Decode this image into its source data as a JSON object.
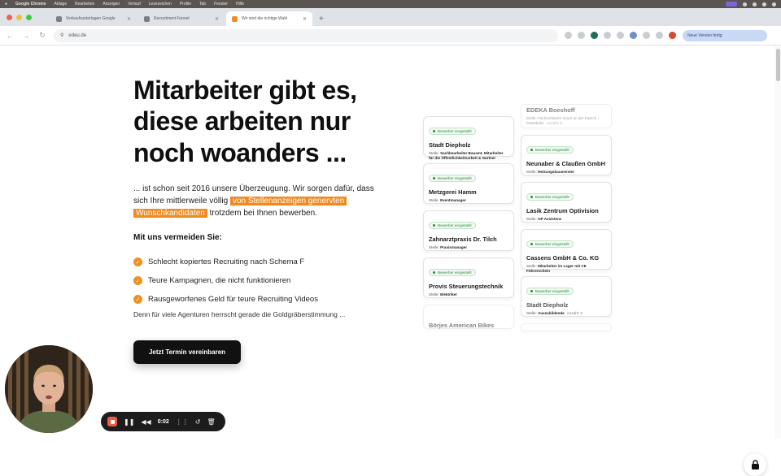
{
  "os_menubar": {
    "app_name": "Google Chrome",
    "menus": [
      "Ablage",
      "Bearbeiten",
      "Anzeigen",
      "Verlauf",
      "Lesezeichen",
      "Profile",
      "Tab",
      "Fenster",
      "Hilfe"
    ]
  },
  "browser": {
    "tabs": [
      {
        "title": "Verkaufsunterlagen Google",
        "active": false
      },
      {
        "title": "Recruitment Funnel",
        "active": false
      },
      {
        "title": "Wir sind die richtige Wahl",
        "active": true
      }
    ],
    "new_tab_label": "+",
    "url": "edeu.de",
    "profile_button_label": "Neue Version fertig",
    "nav": {
      "back": "←",
      "forward": "→",
      "reload": "↻"
    }
  },
  "hero": {
    "title_lines": [
      "Mitarbeiter gibt es,",
      "diese arbeiten nur",
      "noch woanders ..."
    ],
    "lead_before": "... ist schon seit 2016 unsere Überzeugung. Wir sorgen dafür, dass sich Ihre mittlerweile völlig",
    "lead_highlight_1": "von Stellenanzeigen genervten",
    "lead_highlight_2": "Wunschkandidaten",
    "lead_after": "trotzdem bei Ihnen bewerben.",
    "avoid_heading": "Mit uns vermeiden Sie:",
    "avoid_items": [
      "Schlecht kopiertes Recruiting nach Schema F",
      "Teure Kampagnen, die nicht funktionieren",
      "Rausgeworfenes Geld für teure Recruiting Videos"
    ],
    "footnote": "Denn für viele Agenturen herrscht gerade die Goldgräberstimmung ...",
    "cta_label": "Jetzt Termin vereinbaren"
  },
  "cards": {
    "badge_label": "Bewerber eingestellt",
    "role_prefix": "Stelle:",
    "left": [
      {
        "name": "Stadt Diepholz",
        "role": "Sachbearbeiter Bauamt, Mitarbeiter für die Öffentlichkeitsarbeit & Gärtner",
        "extra": ""
      },
      {
        "name": "Metzgerei Hamm",
        "role": "Eventmanager",
        "extra": ""
      },
      {
        "name": "Zahnarztpraxis Dr. Tilch",
        "role": "Praxismanager",
        "extra": ""
      },
      {
        "name": "Provis Steuerungstechnik",
        "role": "Elektriker",
        "extra": ""
      },
      {
        "name": "Börjes American Bikes",
        "role": "",
        "extra": ""
      }
    ],
    "right": [
      {
        "name": "EDEKA Boeshoff",
        "role": "Fachverkäufer Innen an der Fleisch / Käsetheke",
        "extra": "Anzahl: 5"
      },
      {
        "name": "Neunaber & Claußen GmbH",
        "role": "Heizungsbaumeister",
        "extra": ""
      },
      {
        "name": "Lasik Zentrum Optivision",
        "role": "OP Assistenz",
        "extra": ""
      },
      {
        "name": "Cassens GmbH & Co. KG",
        "role": "Mitarbeiter im Lager mit CE Führerschein",
        "extra": ""
      },
      {
        "name": "Stadt Diepholz",
        "role": "Auszubildende",
        "extra": "Anzahl: 2"
      }
    ]
  },
  "recorder": {
    "elapsed": "0:02"
  },
  "colors": {
    "accent_orange": "#f08a1f",
    "badge_green": "#2c8a3e",
    "cta_black": "#111111",
    "recorder_red": "#f05a46"
  },
  "icons": {
    "check": "check-icon",
    "stop": "stop-icon",
    "pause": "pause-icon",
    "rewind": "rewind-icon",
    "grid": "grid-icon",
    "undo": "undo-icon",
    "trash": "trash-icon",
    "lock": "lock-icon"
  }
}
